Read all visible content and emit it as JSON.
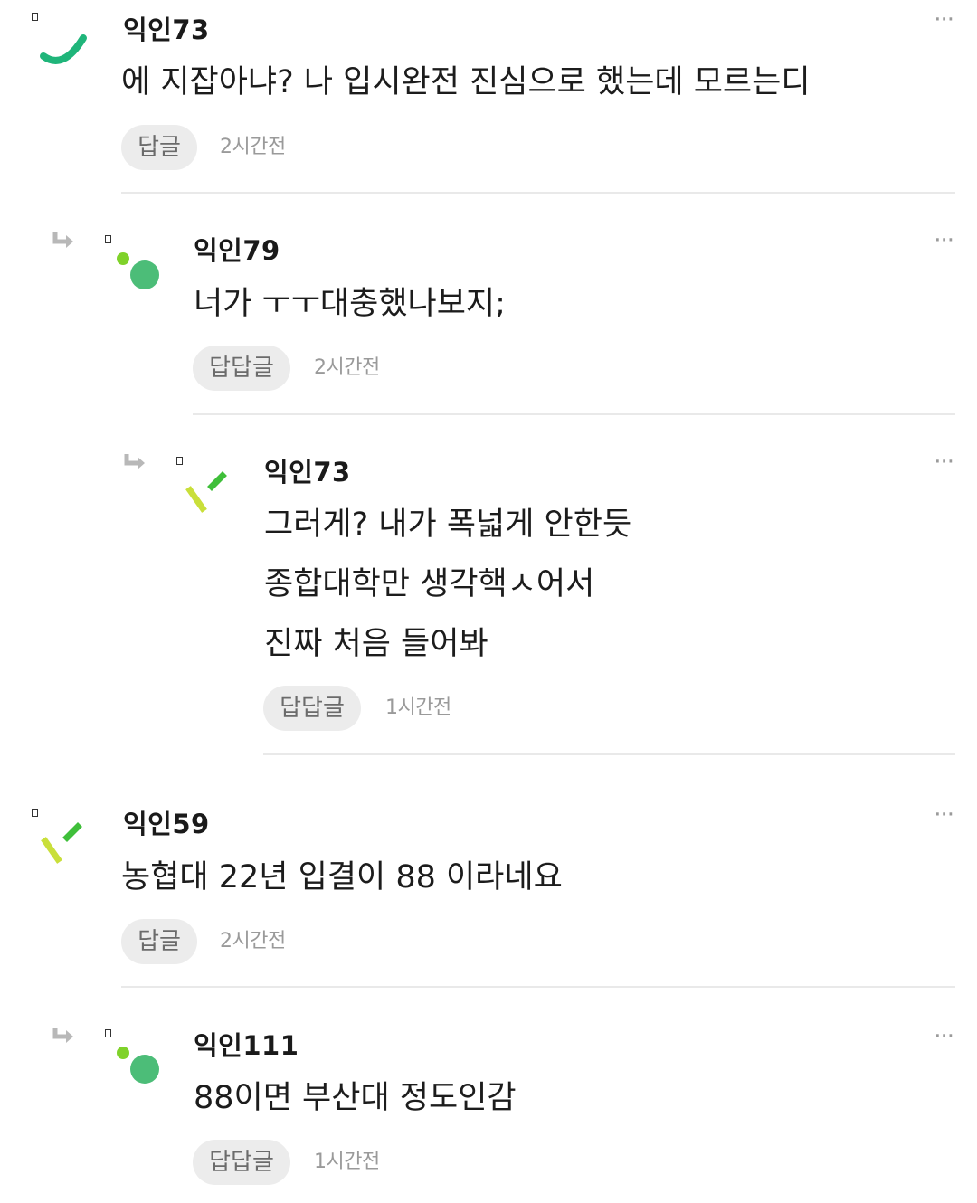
{
  "comments": [
    {
      "author": "익인73",
      "lines": [
        "에 지잡아냐? 나 입시완전 진심으로 했는데 모르는디"
      ],
      "reply_label": "답글",
      "time": "2시간전",
      "more": "···"
    },
    {
      "author": "익인79",
      "lines": [
        "너가 ㅜㅜ대충했나보지;"
      ],
      "reply_label": "답답글",
      "time": "2시간전",
      "more": "···"
    },
    {
      "author": "익인73",
      "lines": [
        "그러게? 내가 폭넓게 안한듯",
        "종합대학만 생각핵ㅅ어서",
        "진짜 처음 들어봐"
      ],
      "reply_label": "답답글",
      "time": "1시간전",
      "more": "···"
    },
    {
      "author": "익인59",
      "lines": [
        "농협대 22년 입결이 88 이라네요"
      ],
      "reply_label": "답글",
      "time": "2시간전",
      "more": "···"
    },
    {
      "author": "익인111",
      "lines": [
        "88이면 부산대 정도인감"
      ],
      "reply_label": "답답글",
      "time": "1시간전",
      "more": "···"
    }
  ],
  "colors": {
    "arc_green": "#1fb57a",
    "dot_lime": "#7fd22a",
    "dot_green": "#4cbd78",
    "stroke_yellow": "#c9df3a",
    "stroke_green": "#3fbf3a",
    "reply_bg": "#ececec"
  }
}
